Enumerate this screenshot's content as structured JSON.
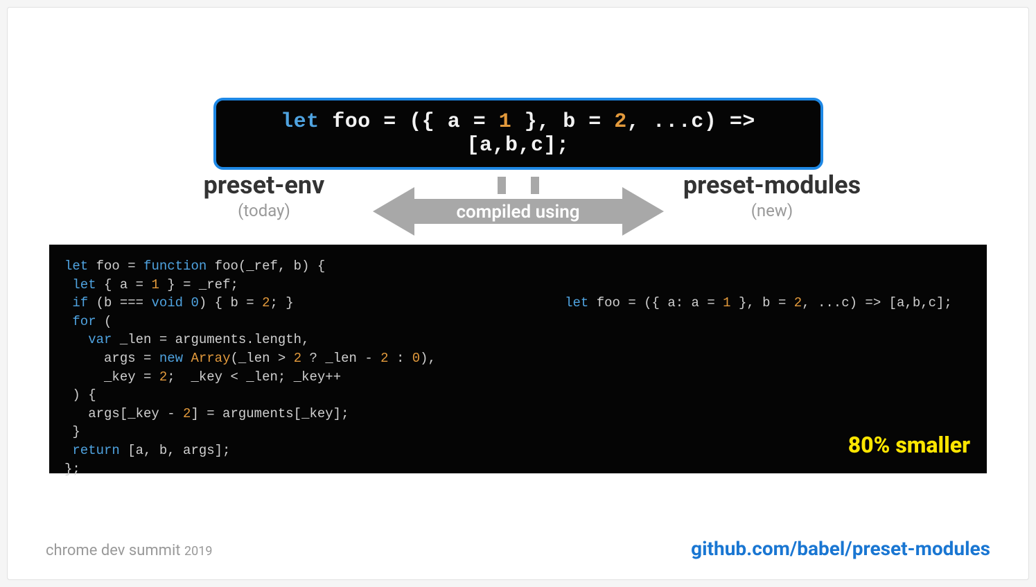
{
  "source_code": {
    "tokens": [
      {
        "t": "let ",
        "c": "k-blue"
      },
      {
        "t": "foo = ({ a = ",
        "c": "k-white"
      },
      {
        "t": "1",
        "c": "k-orange"
      },
      {
        "t": " }, b = ",
        "c": "k-white"
      },
      {
        "t": "2",
        "c": "k-orange"
      },
      {
        "t": ", ...c) => [a,b,c];",
        "c": "k-white"
      }
    ]
  },
  "arrow_label": "compiled using",
  "left": {
    "title": "preset-env",
    "subtitle": "(today)",
    "code_tokens": [
      {
        "t": "let",
        "c": "k-blue"
      },
      {
        "t": " foo = ",
        "c": "k-grey"
      },
      {
        "t": "function",
        "c": "k-blue"
      },
      {
        "t": " foo(_ref, b) {",
        "c": "k-grey"
      },
      {
        "t": "\n ",
        "c": ""
      },
      {
        "t": "let",
        "c": "k-blue"
      },
      {
        "t": " { a = ",
        "c": "k-grey"
      },
      {
        "t": "1",
        "c": "k-orange"
      },
      {
        "t": " } = _ref;",
        "c": "k-grey"
      },
      {
        "t": "\n ",
        "c": ""
      },
      {
        "t": "if",
        "c": "k-blue"
      },
      {
        "t": " (b === ",
        "c": "k-grey"
      },
      {
        "t": "void 0",
        "c": "k-blue"
      },
      {
        "t": ") { b = ",
        "c": "k-grey"
      },
      {
        "t": "2",
        "c": "k-orange"
      },
      {
        "t": "; }",
        "c": "k-grey"
      },
      {
        "t": "\n ",
        "c": ""
      },
      {
        "t": "for",
        "c": "k-blue"
      },
      {
        "t": " (",
        "c": "k-grey"
      },
      {
        "t": "\n   ",
        "c": ""
      },
      {
        "t": "var",
        "c": "k-blue"
      },
      {
        "t": " _len = arguments.length,",
        "c": "k-grey"
      },
      {
        "t": "\n     ",
        "c": ""
      },
      {
        "t": "args = ",
        "c": "k-grey"
      },
      {
        "t": "new",
        "c": "k-blue"
      },
      {
        "t": " ",
        "c": ""
      },
      {
        "t": "Array",
        "c": "k-orange"
      },
      {
        "t": "(_len > ",
        "c": "k-grey"
      },
      {
        "t": "2",
        "c": "k-orange"
      },
      {
        "t": " ? _len - ",
        "c": "k-grey"
      },
      {
        "t": "2",
        "c": "k-orange"
      },
      {
        "t": " : ",
        "c": "k-grey"
      },
      {
        "t": "0",
        "c": "k-orange"
      },
      {
        "t": "),",
        "c": "k-grey"
      },
      {
        "t": "\n     ",
        "c": ""
      },
      {
        "t": "_key = ",
        "c": "k-grey"
      },
      {
        "t": "2",
        "c": "k-orange"
      },
      {
        "t": ";  _key < _len; _key++",
        "c": "k-grey"
      },
      {
        "t": "\n ",
        "c": ""
      },
      {
        "t": ") {",
        "c": "k-grey"
      },
      {
        "t": "\n   ",
        "c": ""
      },
      {
        "t": "args[_key - ",
        "c": "k-grey"
      },
      {
        "t": "2",
        "c": "k-orange"
      },
      {
        "t": "] = arguments[_key];",
        "c": "k-grey"
      },
      {
        "t": "\n ",
        "c": ""
      },
      {
        "t": "}",
        "c": "k-grey"
      },
      {
        "t": "\n ",
        "c": ""
      },
      {
        "t": "return",
        "c": "k-blue"
      },
      {
        "t": " [a, b, args];",
        "c": "k-grey"
      },
      {
        "t": "\n",
        "c": ""
      },
      {
        "t": "};",
        "c": "k-grey"
      }
    ]
  },
  "right": {
    "title": "preset-modules",
    "subtitle": "(new)",
    "code_tokens": [
      {
        "t": "let",
        "c": "k-blue"
      },
      {
        "t": " foo = ({ a: a = ",
        "c": "k-grey"
      },
      {
        "t": "1",
        "c": "k-orange"
      },
      {
        "t": " }, b = ",
        "c": "k-grey"
      },
      {
        "t": "2",
        "c": "k-orange"
      },
      {
        "t": ", ...c) => [a,b,c];",
        "c": "k-grey"
      }
    ],
    "badge": "80% smaller"
  },
  "footer": {
    "event": "chrome dev summit",
    "year": "2019",
    "link": "github.com/babel/preset-modules"
  }
}
